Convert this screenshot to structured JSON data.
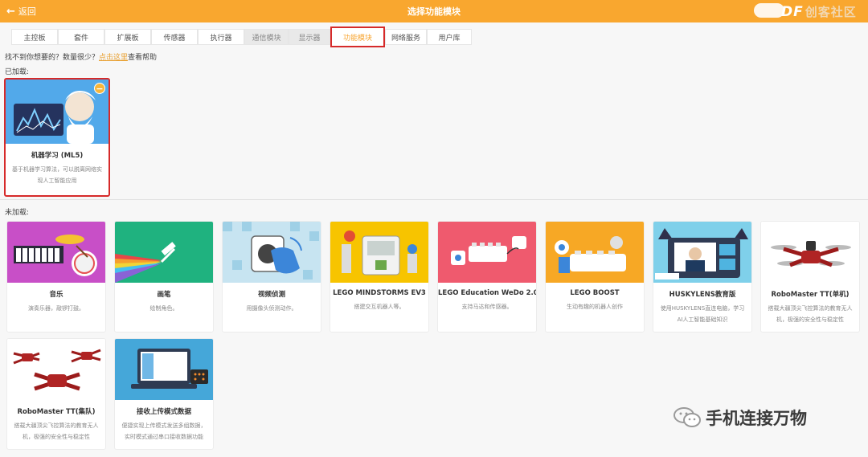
{
  "header": {
    "back_label": "返回",
    "title": "选择功能模块",
    "watermark_brand": "DF",
    "watermark_suffix": "创客社区"
  },
  "tabs": [
    {
      "label": "主控板"
    },
    {
      "label": "套件"
    },
    {
      "label": "扩展板"
    },
    {
      "label": "传感器"
    },
    {
      "label": "执行器"
    },
    {
      "label": "通信模块"
    },
    {
      "label": "显示器"
    },
    {
      "label": "功能模块"
    },
    {
      "label": "网络服务"
    },
    {
      "label": "用户库"
    }
  ],
  "hint": {
    "prefix": "找不到你想要的？数量很少？",
    "link": "点击这里",
    "suffix": "查看帮助"
  },
  "sections": {
    "loaded": "已加载:",
    "unloaded": "未加载:"
  },
  "loaded_cards": [
    {
      "name": "机器学习 (ML5)",
      "desc": "基于机器学习算法，可以脱离网络实现人工智能应用",
      "badge": "−"
    }
  ],
  "unloaded_cards": [
    {
      "name": "音乐",
      "desc": "演奏乐器，敲锣打鼓。"
    },
    {
      "name": "画笔",
      "desc": "绘制角色。"
    },
    {
      "name": "视频侦测",
      "desc": "用摄像头侦测动作。"
    },
    {
      "name": "LEGO MINDSTORMS EV3",
      "desc": "搭建交互机器人等。"
    },
    {
      "name": "LEGO Education WeDo 2.0",
      "desc": "支持马达和传感器。"
    },
    {
      "name": "LEGO BOOST",
      "desc": "生动有趣的机器人创作"
    },
    {
      "name": "HUSKYLENS教育版",
      "desc": "使用HUSKYLENS直连电脑，学习AI人工智能基础知识"
    },
    {
      "name": "RoboMaster TT(单机)",
      "desc": "搭载大疆顶尖飞控算法的教育无人机，极强的安全性与稳定性"
    },
    {
      "name": "RoboMaster TT(集队)",
      "desc": "搭载大疆顶尖飞控算法的教育无人机，极强的安全性与稳定性"
    },
    {
      "name": "接收上传模式数据",
      "desc": "便捷实现上传模式发送多组数据，实时模式通过串口接收数据功能"
    }
  ],
  "watermark_bottom": "手机连接万物",
  "colors": {
    "header": "#f9a72f",
    "highlight": "#d62a2a",
    "link": "#e8a032"
  }
}
